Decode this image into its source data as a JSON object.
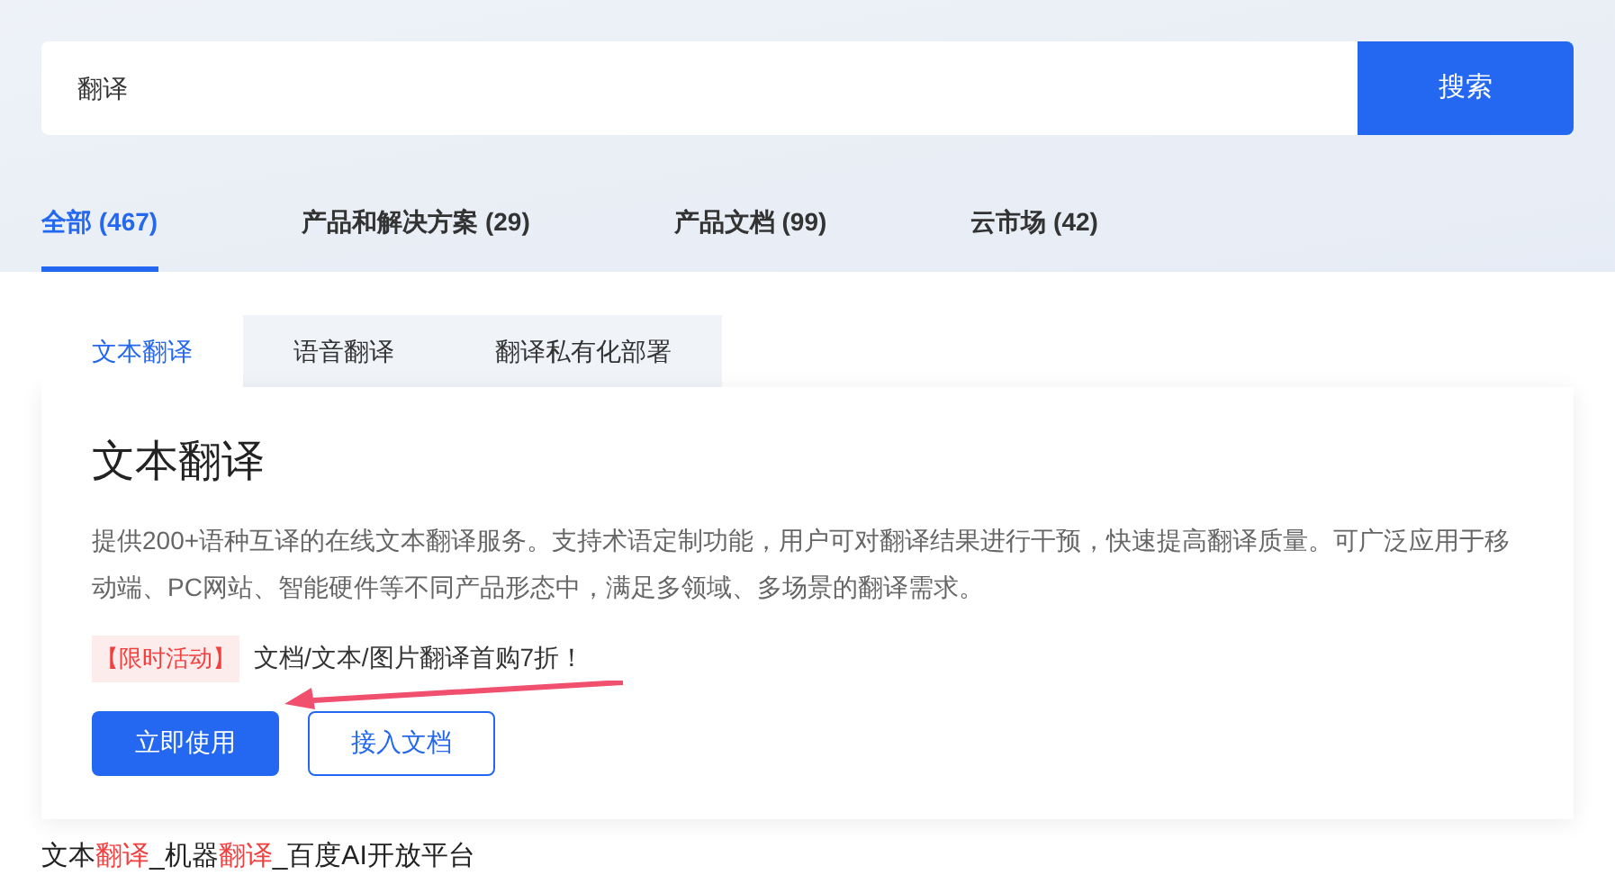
{
  "search": {
    "value": "翻译",
    "button": "搜索"
  },
  "tabs": [
    {
      "label": "全部 (467)",
      "selected": true
    },
    {
      "label": "产品和解决方案 (29)",
      "selected": false
    },
    {
      "label": "产品文档 (99)",
      "selected": false
    },
    {
      "label": "云市场 (42)",
      "selected": false
    }
  ],
  "product_tabs": [
    {
      "label": "文本翻译",
      "selected": true
    },
    {
      "label": "语音翻译",
      "selected": false
    },
    {
      "label": "翻译私有化部署",
      "selected": false
    }
  ],
  "card": {
    "title": "文本翻译",
    "description": "提供200+语种互译的在线文本翻译服务。支持术语定制功能，用户可对翻译结果进行干预，快速提高翻译质量。可广泛应用于移动端、PC网站、智能硬件等不同产品形态中，满足多领域、多场景的翻译需求。",
    "promo_tag": "【限时活动】",
    "promo_text": "文档/文本/图片翻译首购7折！",
    "buttons": [
      {
        "label": "立即使用",
        "kind": "primary"
      },
      {
        "label": "接入文档",
        "kind": "outline"
      }
    ]
  },
  "result_title": [
    {
      "text": "文本",
      "highlight": false
    },
    {
      "text": "翻译",
      "highlight": true
    },
    {
      "text": "_机器",
      "highlight": false
    },
    {
      "text": "翻译",
      "highlight": true
    },
    {
      "text": "_百度AI开放平台",
      "highlight": false
    }
  ]
}
